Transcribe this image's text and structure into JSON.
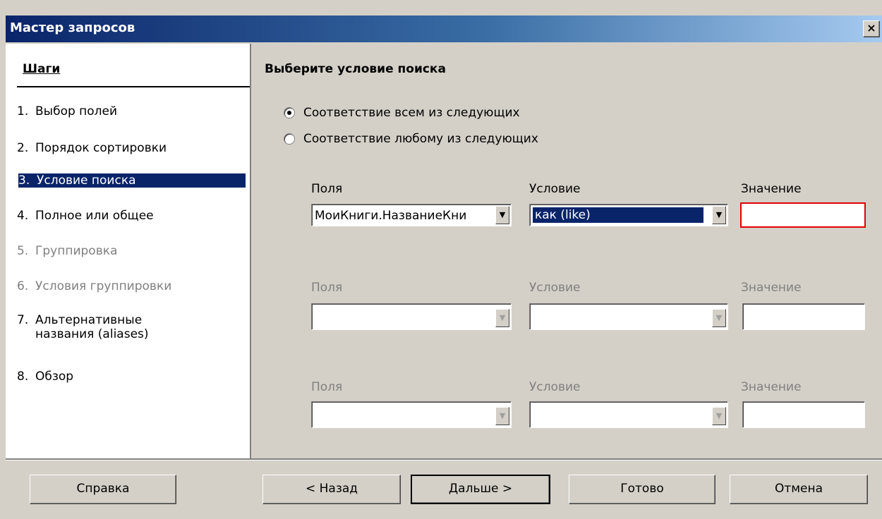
{
  "window": {
    "title": "Мастер запросов",
    "close_label": "×"
  },
  "steps": {
    "header": "Шаги",
    "items": [
      {
        "num": "1.",
        "label": "Выбор полей"
      },
      {
        "num": "2.",
        "label": "Порядок сортировки"
      },
      {
        "num": "3.",
        "label": "Условие поиска"
      },
      {
        "num": "4.",
        "label": "Полное или общее"
      },
      {
        "num": "5.",
        "label": "Группировка"
      },
      {
        "num": "6.",
        "label": "Условия группировки"
      },
      {
        "num": "7.",
        "label": "Альтернативные названия (aliases)"
      },
      {
        "num": "8.",
        "label": "Обзор"
      }
    ]
  },
  "main": {
    "title": "Выберите условие поиска",
    "radio_all": "Соответствие всем из следующих",
    "radio_any": "Соответствие любому из следующих",
    "rows": [
      {
        "fields_label": "Поля",
        "condition_label": "Условие",
        "value_label": "Значение",
        "field_value": "МоиКниги.НазваниеКни",
        "condition_value": "как (like)",
        "value": ""
      },
      {
        "fields_label": "Поля",
        "condition_label": "Условие",
        "value_label": "Значение",
        "field_value": "",
        "condition_value": "",
        "value": ""
      },
      {
        "fields_label": "Поля",
        "condition_label": "Условие",
        "value_label": "Значение",
        "field_value": "",
        "condition_value": "",
        "value": ""
      }
    ]
  },
  "buttons": {
    "help": "Справка",
    "back": "< Назад",
    "next": "Дальше >",
    "finish": "Готово",
    "cancel": "Отмена"
  }
}
